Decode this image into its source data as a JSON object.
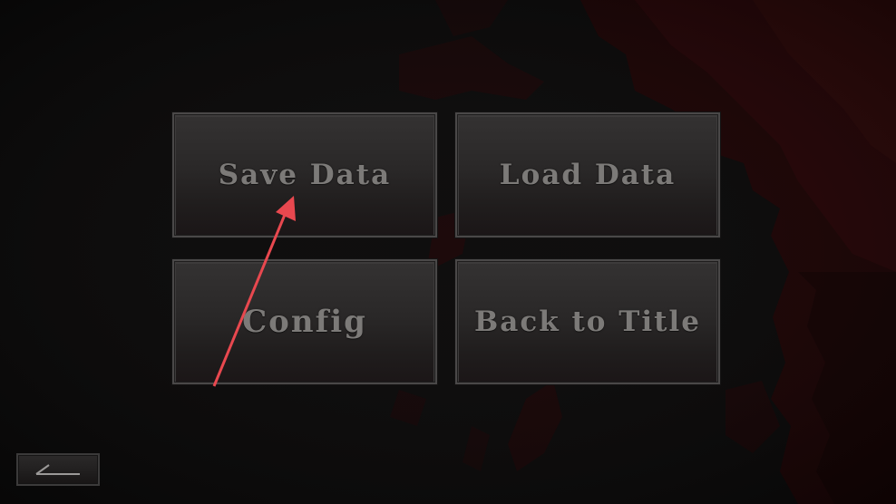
{
  "menu": {
    "save_label": "Save Data",
    "load_label": "Load Data",
    "config_label": "Config",
    "title_label": "Back to Title"
  },
  "footer": {
    "back_icon": "back-arrow-icon"
  },
  "overlay": {
    "pointer_icon": "pointer-arrow-icon",
    "pointer_color": "#e8484f"
  },
  "theme": {
    "background": "#0d0c0c",
    "blood_accent": "#3a0a0c",
    "button_text": "#7c7a78",
    "button_border": "#4a4848"
  }
}
